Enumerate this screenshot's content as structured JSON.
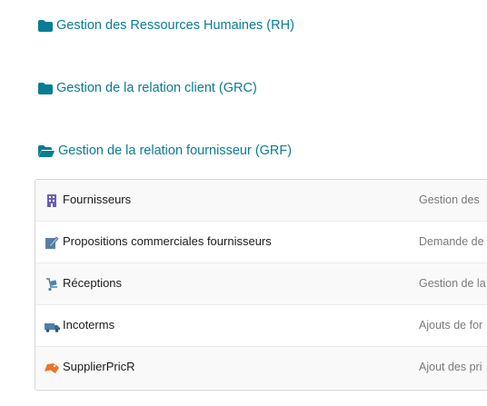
{
  "sections": [
    {
      "label": "Gestion des Ressources Humaines (RH)",
      "icon": "folder-icon",
      "expanded": false
    },
    {
      "label": "Gestion de la relation client (GRC)",
      "icon": "folder-icon",
      "expanded": false
    },
    {
      "label": "Gestion de la relation fournisseur (GRF)",
      "icon": "folder-open-icon",
      "expanded": true
    }
  ],
  "grf_items": [
    {
      "label": "Fournisseurs",
      "description": "Gestion des",
      "icon": "building-icon"
    },
    {
      "label": "Propositions commerciales fournisseurs",
      "description": "Demande de",
      "icon": "document-edit-icon"
    },
    {
      "label": "Réceptions",
      "description": "Gestion de la",
      "icon": "dolly-icon"
    },
    {
      "label": "Incoterms",
      "description": "Ajouts de for",
      "icon": "truck-icon"
    },
    {
      "label": "SupplierPricR",
      "description": "Ajout des pri",
      "icon": "price-tag-icon"
    }
  ],
  "colors": {
    "link": "#0a7c94",
    "row_alt": "#f9f9f9",
    "border": "#d6d6d6"
  }
}
